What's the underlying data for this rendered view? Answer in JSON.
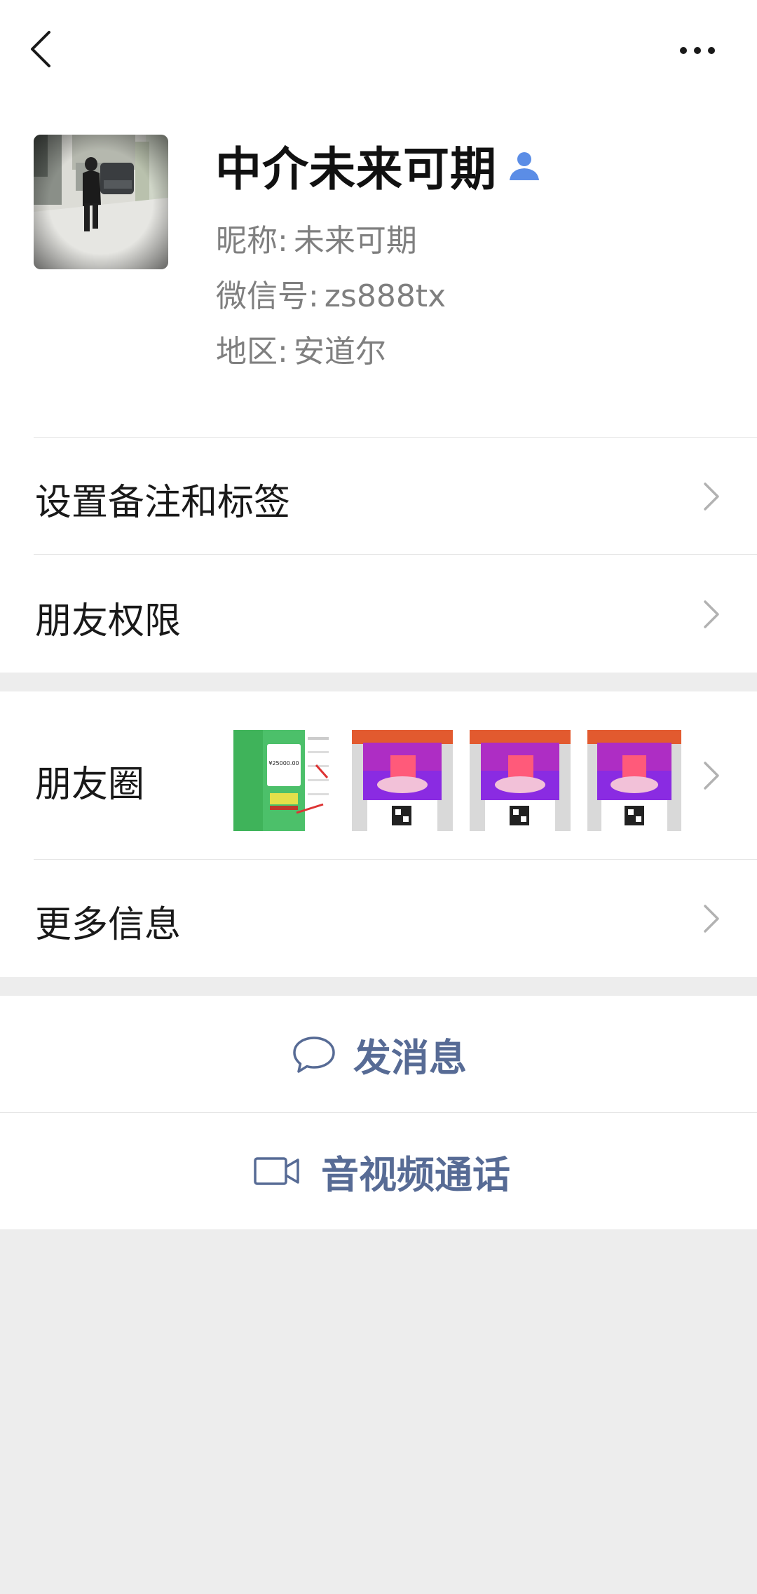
{
  "profile": {
    "display_name": "中介未来可期",
    "nickname_label": "昵称:",
    "nickname": "未来可期",
    "wechat_id_label": "微信号:",
    "wechat_id": "zs888tx",
    "region_label": "地区:",
    "region": "安道尔"
  },
  "menu": {
    "remarks_tags": "设置备注和标签",
    "permissions": "朋友权限",
    "moments": "朋友圈",
    "more_info": "更多信息"
  },
  "moments_thumbnails": [
    {
      "caption": "¥25000.00"
    },
    {
      "caption": ""
    },
    {
      "caption": ""
    },
    {
      "caption": ""
    }
  ],
  "actions": {
    "send_message": "发消息",
    "video_call": "音视频通话"
  },
  "colors": {
    "link_blue": "#576b95",
    "contact_icon_blue": "#5b8de6",
    "background": "#ededed"
  }
}
